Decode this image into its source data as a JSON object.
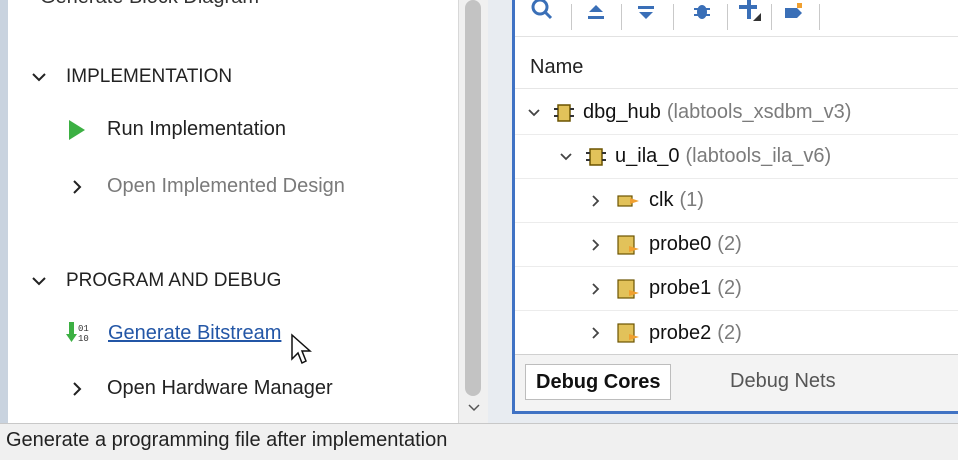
{
  "left_panel": {
    "clipped_top_text": "Generate Block Diagram",
    "sections": [
      {
        "title": "IMPLEMENTATION",
        "items": [
          {
            "label": "Run Implementation",
            "icon": "play-icon",
            "enabled": true
          },
          {
            "label": "Open Implemented Design",
            "icon": "chevron-right-icon",
            "enabled": false
          }
        ]
      },
      {
        "title": "PROGRAM AND DEBUG",
        "items": [
          {
            "label": "Generate Bitstream",
            "icon": "bitstream-icon",
            "hovered": true
          },
          {
            "label": "Open Hardware Manager",
            "icon": "chevron-right-icon",
            "enabled": true
          }
        ]
      }
    ]
  },
  "debug_panel": {
    "toolbar_icons": [
      "search-icon",
      "collapse-all-icon",
      "expand-all-icon",
      "debug-bug-icon",
      "add-debug-probe-icon",
      "mark-debug-icon"
    ],
    "column_header": "Name",
    "rows": [
      {
        "name": "dbg_hub",
        "type": "(labtools_xsdbm_v3)",
        "icon": "debug-core-icon",
        "expanded": true
      },
      {
        "name": "u_ila_0",
        "type": "(labtools_ila_v6)",
        "icon": "debug-core-icon",
        "expanded": true
      },
      {
        "name": "clk",
        "type": "(1)",
        "icon": "clock-net-icon",
        "expanded": false
      },
      {
        "name": "probe0",
        "type": "(2)",
        "icon": "probe-icon",
        "expanded": false
      },
      {
        "name": "probe1",
        "type": "(2)",
        "icon": "probe-icon",
        "expanded": false
      },
      {
        "name": "probe2",
        "type": "(2)",
        "icon": "probe-icon",
        "expanded": false
      }
    ],
    "tabs": [
      {
        "label": "Debug Cores",
        "active": true
      },
      {
        "label": "Debug Nets",
        "active": false
      }
    ]
  },
  "status_bar": {
    "text": "Generate a programming file after implementation"
  },
  "colors": {
    "accent_blue": "#3f72c4",
    "run_green": "#3cb043",
    "link_blue": "#2356a6",
    "icon_yellow": "#e2c25a"
  }
}
